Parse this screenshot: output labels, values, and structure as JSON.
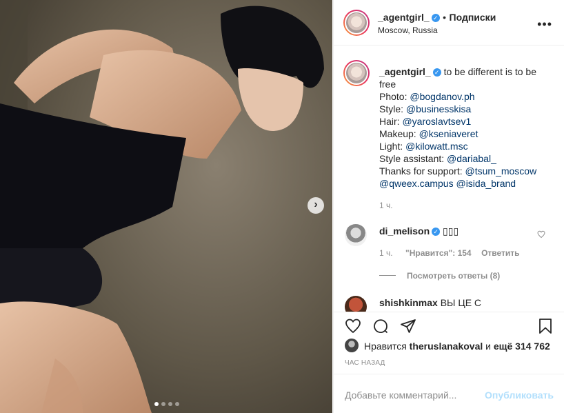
{
  "post": {
    "username": "_agentgirl_",
    "separator": "•",
    "follow_label": "Подписки",
    "location": "Moscow, Russia",
    "more_label": "•••"
  },
  "caption": {
    "username": "_agentgirl_",
    "text_1": "to be different is to be",
    "text_2": "free",
    "photo_label": "Photo:",
    "photo_link": "@bogdanov.ph",
    "style_label": "Style:",
    "style_link": "@businesskisa",
    "hair_label": "Hair:",
    "hair_link": "@yaroslavtsev1",
    "makeup_label": "Makeup:",
    "makeup_link": "@kseniaveret",
    "light_label": "Light:",
    "light_link": "@kilowatt.msc",
    "assistant_label": "Style assistant:",
    "assistant_link": "@dariabal_",
    "support_label": "Thanks for support:",
    "support_link_1": "@tsum_moscow",
    "support_link_2": "@qweex.campus",
    "support_link_3": "@isida_brand",
    "time": "1 ч."
  },
  "comment": {
    "username": "di_melison",
    "text": "▯▯▯",
    "time": "1 ч.",
    "likes_label": "\"Нравится\": 154",
    "reply_label": "Ответить",
    "view_replies": "Посмотреть ответы (8)"
  },
  "next_comment": {
    "username": "shishkinmax",
    "text": "ВЫ ЦЕ С"
  },
  "likes": {
    "prefix": "Нравится",
    "user": "theruslanakoval",
    "middle": "и",
    "count": "ещё 314 762"
  },
  "timestamp": "ЧАС НАЗАД",
  "add_comment": {
    "placeholder": "Добавьте комментарий...",
    "publish": "Опубликовать"
  },
  "carousel": {
    "total": 4,
    "active": 1
  },
  "colors": {
    "link": "#003569",
    "verified": "#3897f0",
    "muted": "#8e8e8e",
    "publish": "#b2dffc"
  }
}
